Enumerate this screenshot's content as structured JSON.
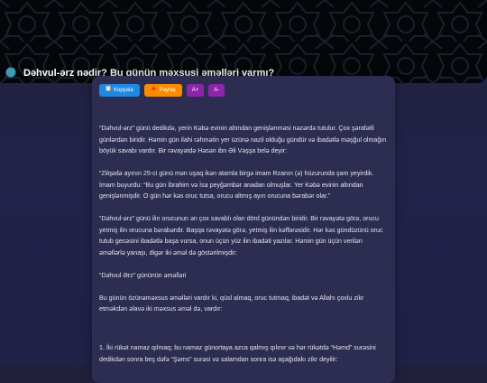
{
  "page": {
    "title": "Dəhvul-ərz nədir? Bu günün məxsusi əməlləri varmı?",
    "title_icon": "globe-icon"
  },
  "toolbar": {
    "copy_label": "Kopyala",
    "copy_icon": "clipboard-icon",
    "share_label": "Paylaş",
    "share_icon": "share-icon",
    "font_increase": "A+",
    "font_decrease": "A-"
  },
  "article": {
    "paragraphs": [
      "“Dəhvul-ərz” günü dedikdə, yerin Kəbə evinin altından genişlənməsi nəzərdə tutulur. Çox şərafətli günlərdən biridir. Həmin gün ilahi rəhmətin yer üzünə nazil olduğu gündür və ibadətlə məşğul olmağın böyük savabı vardır. Bir rəvayətdə Həsən ibn Əli Vəşşa belə deyir:",
      "“Zilqədə ayının 25-ci günü mən uşaq ikən atamla birgə imam Rzanın (ə) hüzurunda şam yeyirdik. İmam buyurdu: “Bu gün İbrahim və İsa peyğəmbər anadan olmuşlar. Yer Kəbə evinin altından genişlənmişdir. O gün hər kəs oruc tutsa, orucu altmış ayın orucuna bərabər olar.”",
      "“Dəhvul-ərz” günü ilin orucunun ən çox savablı olan dörd günündən biridir. Bir rəvayətə görə, orucu yetmiş ilin orucuna bərabərdir. Başqa rəvayətə görə, yetmiş ilin kəffarəsidir. Hər kəs gündüzünü oruc tutub gecəsini ibadətlə başa vursa, onun üçün yüz ilin ibadəti yazılar. Həmin gün üçün verilən əməllərlə yanaşı, digər iki əməl də göstərilmişdir:",
      "“Dəhvul Ərz” gününün əməlləri",
      "Bu günün özünəməxsus əməlləri vardır ki, qüsl almaq, oruc tutmaq, ibadət və Allahı çoxlu zikr etməkdən əlavə iki məxsus əməl də, vardır:",
      "1. İki rükət namaz qılmaq; bu namaz günortaya azca qalmış qılınır və hər rükətdə “Həmd” surəsini dedikdən sonra beş dəfə “Şəms” surəsi və salamdan sonra isə aşağıdakı zikr deyilir:"
    ]
  }
}
